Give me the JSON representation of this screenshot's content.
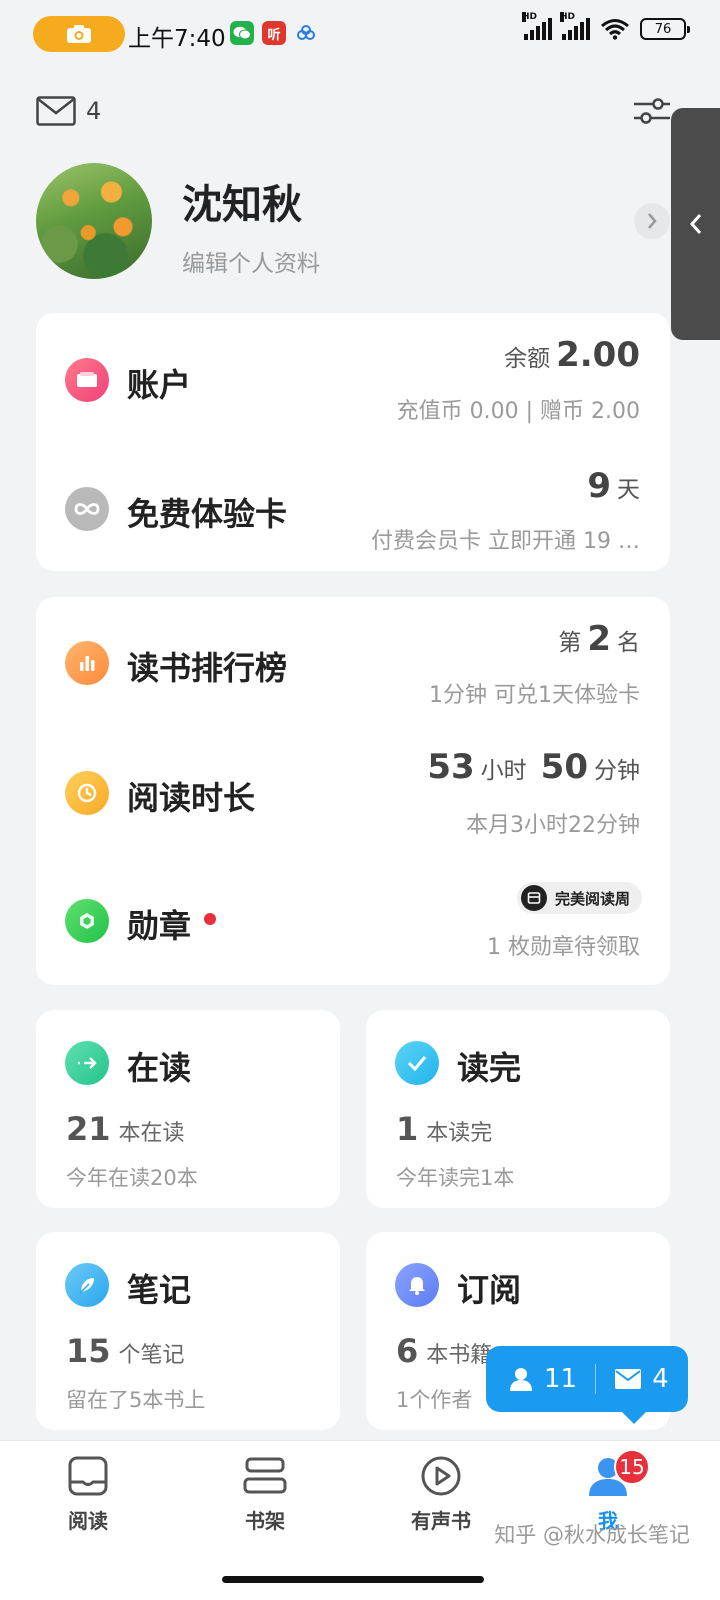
{
  "status_bar": {
    "time": "上午7:40",
    "battery": "76",
    "hd1": "HD",
    "hd2": "HD",
    "notif_icons": [
      "camera-icon",
      "wechat-icon",
      "ting-icon",
      "cloud-icon"
    ],
    "notif_app_text": "听"
  },
  "header": {
    "mail_count": "4"
  },
  "profile": {
    "name": "沈知秋",
    "edit_label": "编辑个人资料"
  },
  "account_card": {
    "account": {
      "title": "账户",
      "balance_label": "余额",
      "balance_value": "2.00",
      "sub": "充值币 0.00 | 赠币 2.00"
    },
    "trial": {
      "title": "免费体验卡",
      "days_value": "9",
      "days_unit": "天",
      "sub": "付费会员卡 立即开通 19 …"
    }
  },
  "stats_card": {
    "ranking": {
      "title": "读书排行榜",
      "prefix": "第",
      "value": "2",
      "suffix": "名",
      "sub": "1分钟 可兑1天体验卡"
    },
    "reading_time": {
      "title": "阅读时长",
      "hours": "53",
      "hours_unit": "小时",
      "minutes": "50",
      "minutes_unit": "分钟",
      "sub": "本月3小时22分钟"
    },
    "medals": {
      "title": "勋章",
      "chip_label": "完美阅读周",
      "sub": "1 枚勋章待领取"
    }
  },
  "grid": {
    "reading": {
      "title": "在读",
      "count": "21",
      "unit": "本在读",
      "sub": "今年在读20本"
    },
    "finished": {
      "title": "读完",
      "count": "1",
      "unit": "本读完",
      "sub": "今年读完1本"
    },
    "notes": {
      "title": "笔记",
      "count": "15",
      "unit": "个笔记",
      "sub": "留在了5本书上"
    },
    "subscribe": {
      "title": "订阅",
      "count": "6",
      "unit": "本书籍",
      "sub": "1个作者"
    }
  },
  "float_bubble": {
    "followers": "11",
    "messages": "4"
  },
  "bottom_nav": {
    "items": [
      {
        "label": "阅读",
        "icon": "read-icon"
      },
      {
        "label": "书架",
        "icon": "bookshelf-icon"
      },
      {
        "label": "有声书",
        "icon": "audiobook-icon"
      },
      {
        "label": "我",
        "icon": "me-icon"
      }
    ],
    "me_badge": "15"
  },
  "watermark": "知乎 @秋水成长笔记",
  "colors": {
    "accent": "#1a8ff0",
    "badge_red": "#e8303a",
    "camera_pill": "#f6ab1e"
  }
}
